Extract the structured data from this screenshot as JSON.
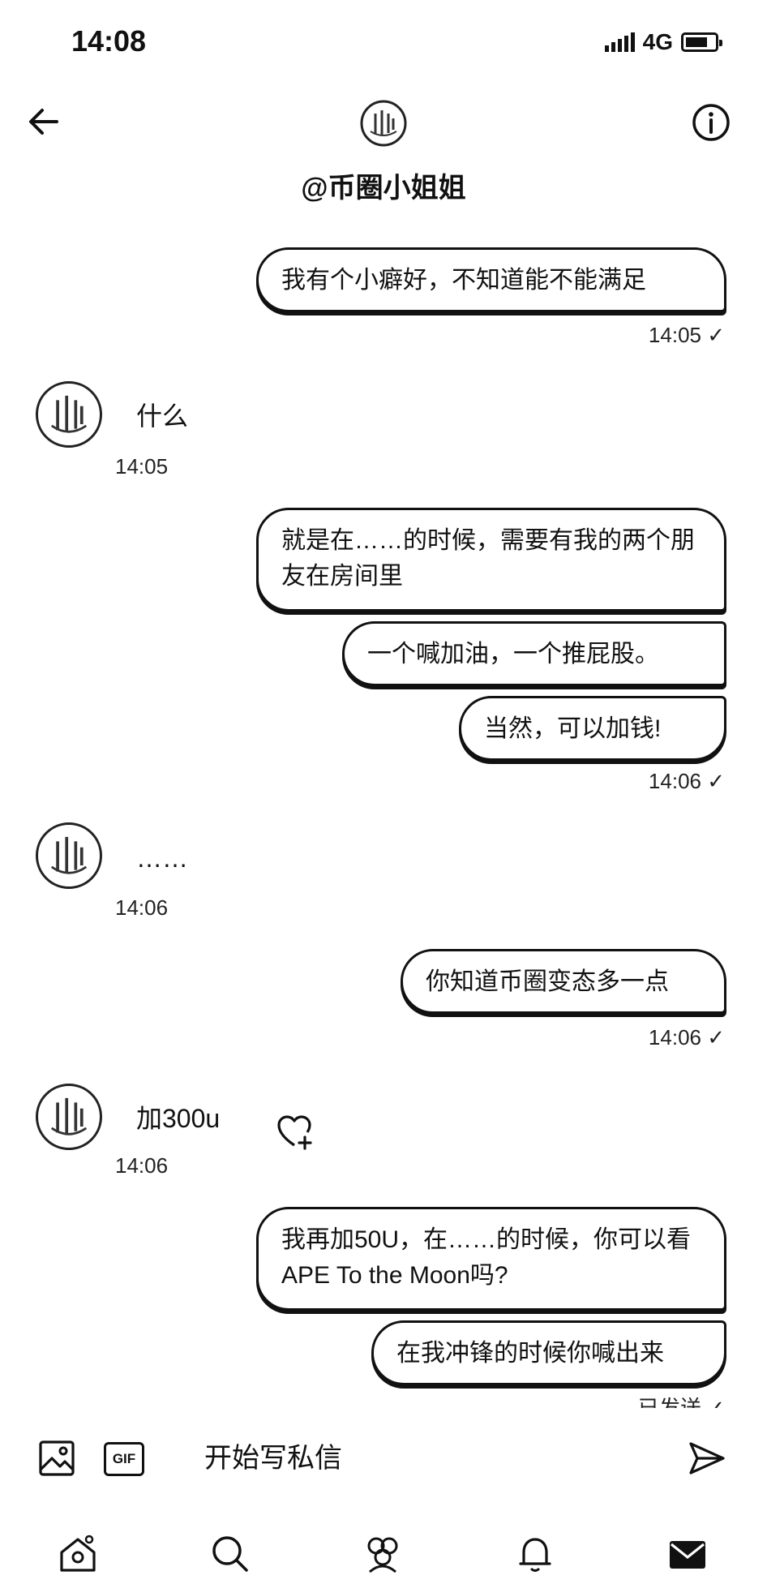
{
  "status_bar": {
    "time": "14:08",
    "network": "4G"
  },
  "header": {
    "title": "@币圈小姐姐"
  },
  "messages": {
    "sent1": {
      "text": "我有个小癖好，不知道能不能满足",
      "time": "14:05 ✓"
    },
    "recv1": {
      "text": "什么",
      "time": "14:05"
    },
    "sent2a": {
      "text": "就是在……的时候，需要有我的两个朋友在房间里"
    },
    "sent2b": {
      "text": "一个喊加油，一个推屁股。"
    },
    "sent2c": {
      "text": "当然，可以加钱!",
      "time": "14:06 ✓"
    },
    "recv2": {
      "text": "……",
      "time": "14:06"
    },
    "sent3": {
      "text": "你知道币圈变态多一点",
      "time": "14:06 ✓"
    },
    "recv3": {
      "text": "加300u",
      "time": "14:06"
    },
    "sent4a": {
      "text": "我再加50U，在……的时候，你可以看APE To the Moon吗?"
    },
    "sent4b": {
      "text": "在我冲锋的时候你喊出来",
      "time": "已发送 ✓"
    }
  },
  "composer": {
    "gif_label": "GIF",
    "placeholder": "开始写私信"
  },
  "icons": {
    "back": "arrow-left-icon",
    "info": "info-icon",
    "heart": "heart-plus-icon",
    "image": "image-icon",
    "send": "send-icon",
    "nav": [
      "home-icon",
      "search-icon",
      "communities-icon",
      "notifications-icon",
      "messages-icon"
    ]
  }
}
